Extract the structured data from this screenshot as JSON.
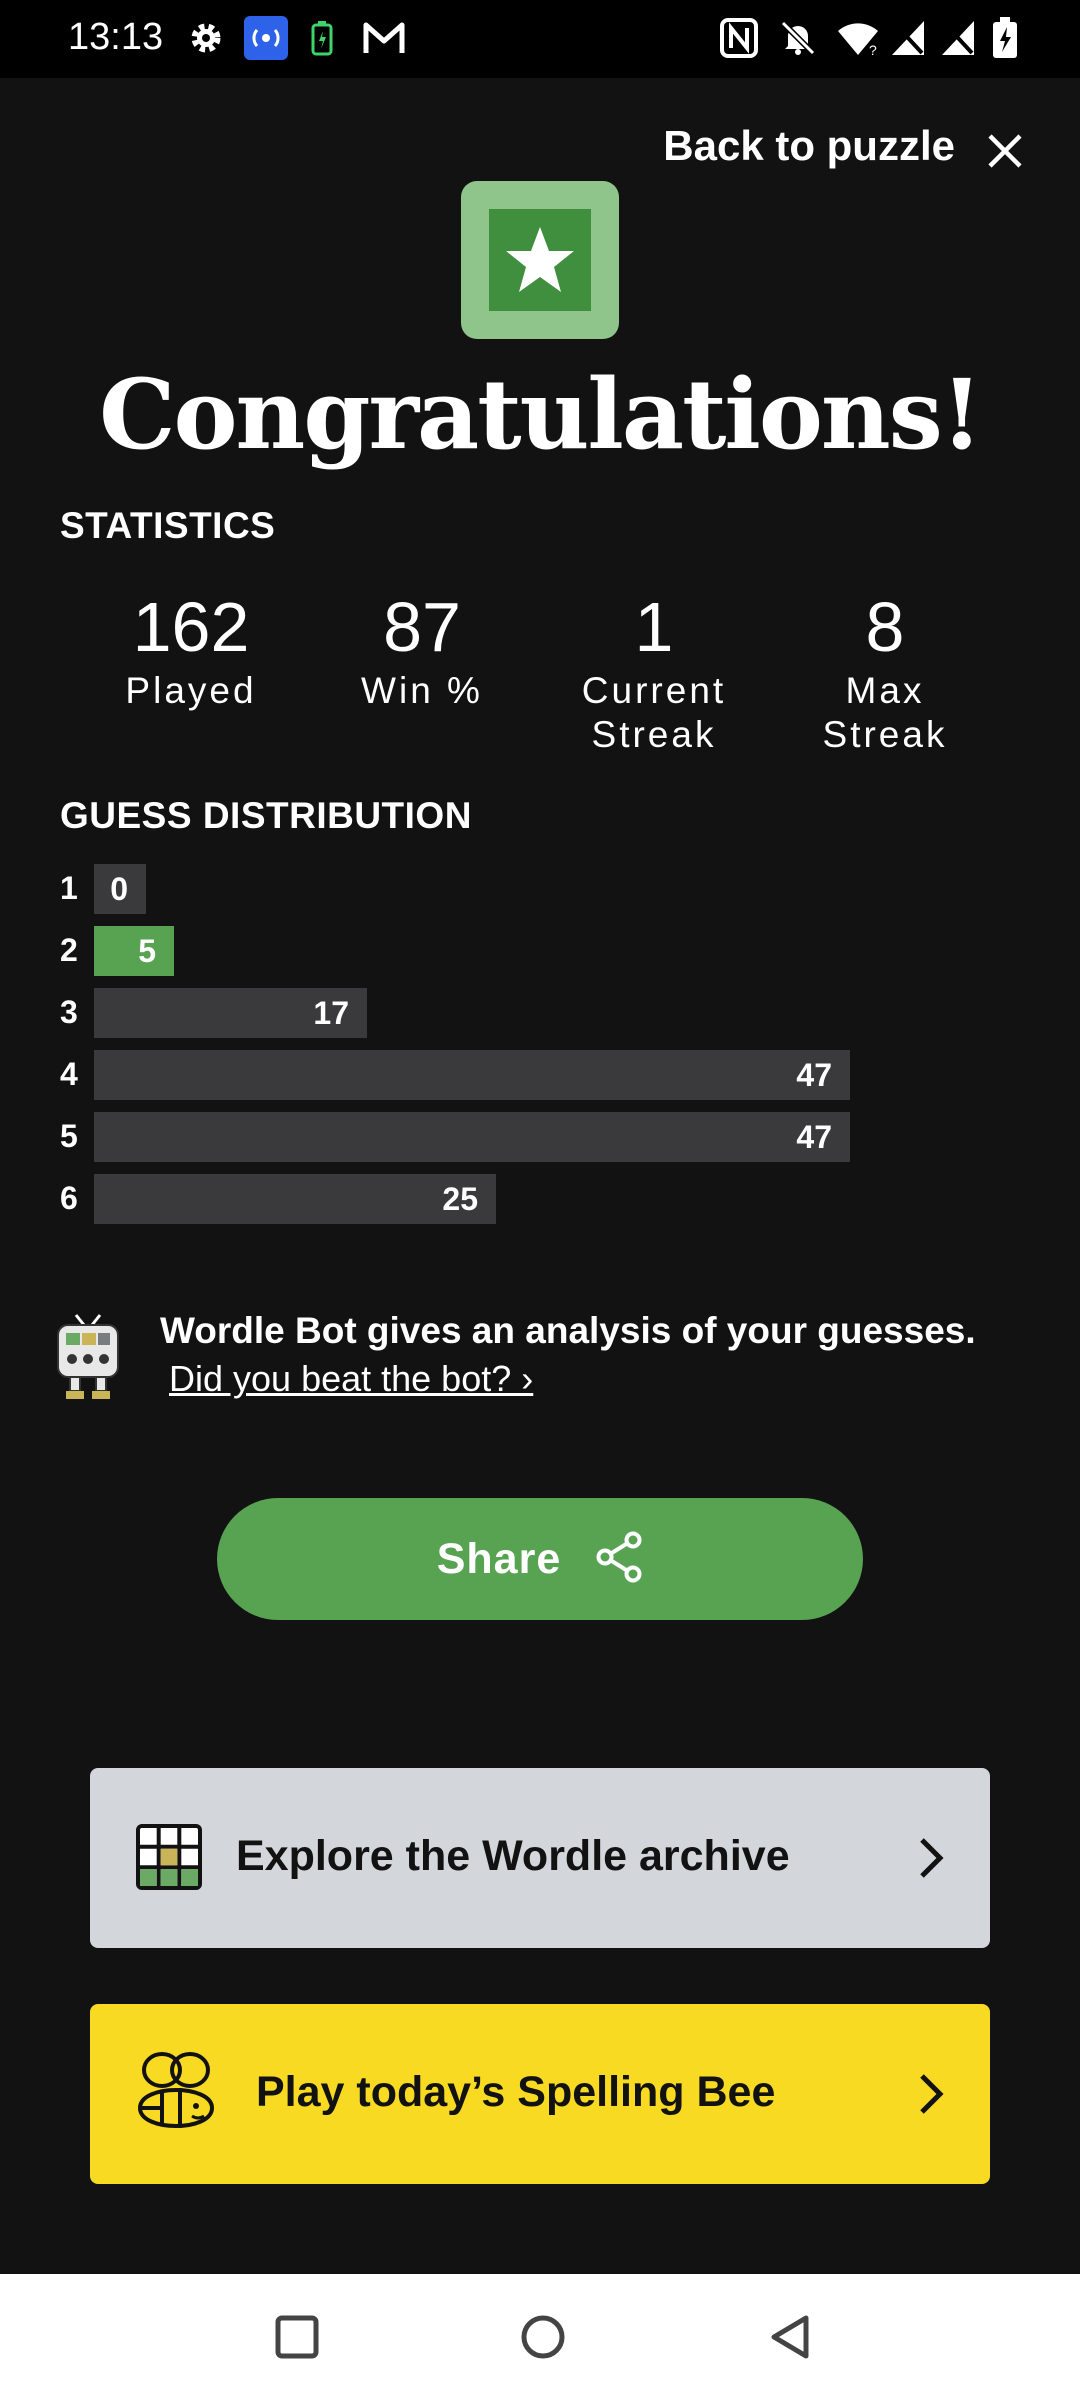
{
  "status_bar": {
    "time": "13:13",
    "left_icons": [
      "settings-icon",
      "hotspot-icon",
      "battery-saver-icon",
      "gmail-icon"
    ],
    "right_icons": [
      "nfc-icon",
      "mute-icon",
      "wifi-icon",
      "signal-icon",
      "signal-icon",
      "battery-icon"
    ]
  },
  "header": {
    "back_label": "Back to puzzle",
    "close_icon": "close-icon"
  },
  "badge_icon": "star-icon",
  "title": "Congratulations!",
  "statistics": {
    "heading": "STATISTICS",
    "items": [
      {
        "value": "162",
        "label_line1": "Played",
        "label_line2": ""
      },
      {
        "value": "87",
        "label_line1": "Win %",
        "label_line2": ""
      },
      {
        "value": "1",
        "label_line1": "Current",
        "label_line2": "Streak"
      },
      {
        "value": "8",
        "label_line1": "Max",
        "label_line2": "Streak"
      }
    ]
  },
  "guess_distribution": {
    "heading": "GUESS DISTRIBUTION",
    "max": 47,
    "current_guess": 2,
    "rows": [
      {
        "guess": "1",
        "count": 0
      },
      {
        "guess": "2",
        "count": 5
      },
      {
        "guess": "3",
        "count": 17
      },
      {
        "guess": "4",
        "count": 47
      },
      {
        "guess": "5",
        "count": 47
      },
      {
        "guess": "6",
        "count": 25
      }
    ]
  },
  "wordle_bot": {
    "icon": "robot-icon",
    "text": "Wordle Bot gives an analysis of your guesses.",
    "link": "Did you beat the bot? ›"
  },
  "share": {
    "label": "Share",
    "icon": "share-icon",
    "color": "#58a351"
  },
  "cards": [
    {
      "label": "Explore the Wordle archive",
      "icon": "wordle-grid-icon",
      "color": "#d3d6da"
    },
    {
      "label": "Play today’s Spelling Bee",
      "icon": "bee-icon",
      "color": "#f7da21"
    }
  ],
  "nav_bar": {
    "buttons": [
      "recents-icon",
      "home-icon",
      "back-icon"
    ]
  }
}
